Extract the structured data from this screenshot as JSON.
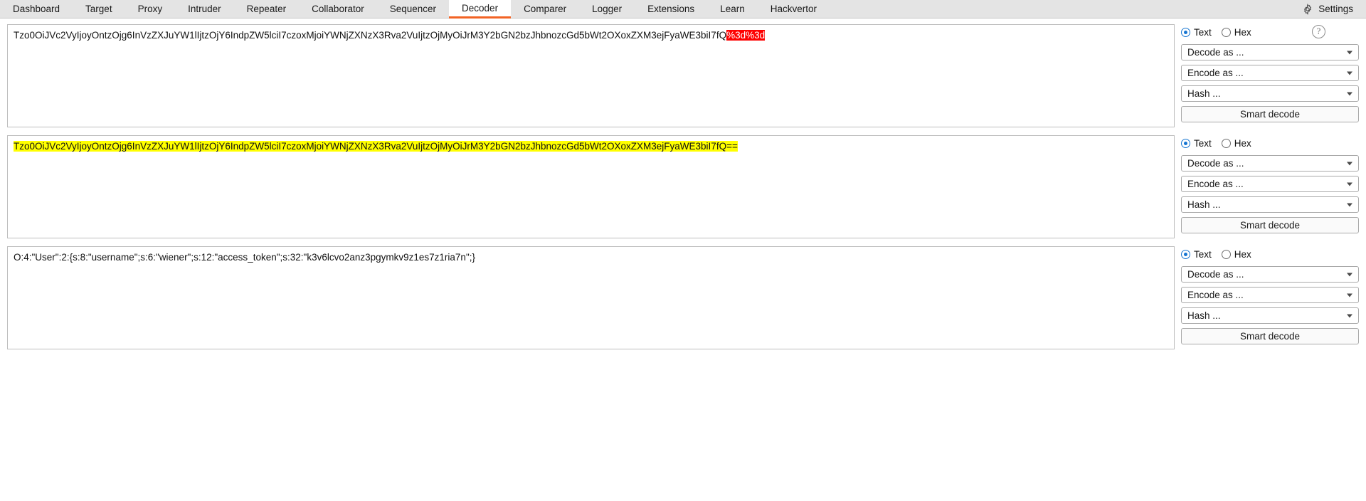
{
  "tabs": [
    {
      "label": "Dashboard",
      "active": false
    },
    {
      "label": "Target",
      "active": false
    },
    {
      "label": "Proxy",
      "active": false
    },
    {
      "label": "Intruder",
      "active": false
    },
    {
      "label": "Repeater",
      "active": false
    },
    {
      "label": "Collaborator",
      "active": false
    },
    {
      "label": "Sequencer",
      "active": false
    },
    {
      "label": "Decoder",
      "active": true
    },
    {
      "label": "Comparer",
      "active": false
    },
    {
      "label": "Logger",
      "active": false
    },
    {
      "label": "Extensions",
      "active": false
    },
    {
      "label": "Learn",
      "active": false
    },
    {
      "label": "Hackvertor",
      "active": false
    }
  ],
  "settings": {
    "label": "Settings",
    "icon": "gear-icon"
  },
  "colors": {
    "accent": "#f26324",
    "tabbar_bg": "#e4e4e4",
    "radio_selected": "#1675d1",
    "highlight_red": "#fe0000",
    "highlight_yellow": "#ffff00"
  },
  "controls": {
    "text_label": "Text",
    "hex_label": "Hex",
    "decode_as": "Decode as ...",
    "encode_as": "Encode as ...",
    "hash": "Hash ...",
    "smart_decode": "Smart decode",
    "help_glyph": "?",
    "selected_format": "Text"
  },
  "panels": [
    {
      "id": "panel-1",
      "text_plain": "Tzo0OiJVc2VyIjoyOntzOjg6InVzZXJuYW1lIjtzOjY6IndpZW5lciI7czoxMjoiYWNjZXNzX3Rva2VuIjtzOjMyOiJrM3Y2bGN2bzJhbnozcGd5bWt2OXoxZXM3ejFyaWE3biI7fQ",
      "text_highlight": "%3d%3d",
      "highlight_style": "red"
    },
    {
      "id": "panel-2",
      "text_plain": "",
      "text_highlight": "Tzo0OiJVc2VyIjoyOntzOjg6InVzZXJuYW1lIjtzOjY6IndpZW5lciI7czoxMjoiYWNjZXNzX3Rva2VuIjtzOjMyOiJrM3Y2bGN2bzJhbnozcGd5bWt2OXoxZXM3ejFyaWE3biI7fQ==",
      "highlight_style": "yellow"
    },
    {
      "id": "panel-3",
      "text_plain": "O:4:\"User\":2:{s:8:\"username\";s:6:\"wiener\";s:12:\"access_token\";s:32:\"k3v6lcvo2anz3pgymkv9z1es7z1ria7n\";}",
      "text_highlight": "",
      "highlight_style": "none"
    }
  ]
}
